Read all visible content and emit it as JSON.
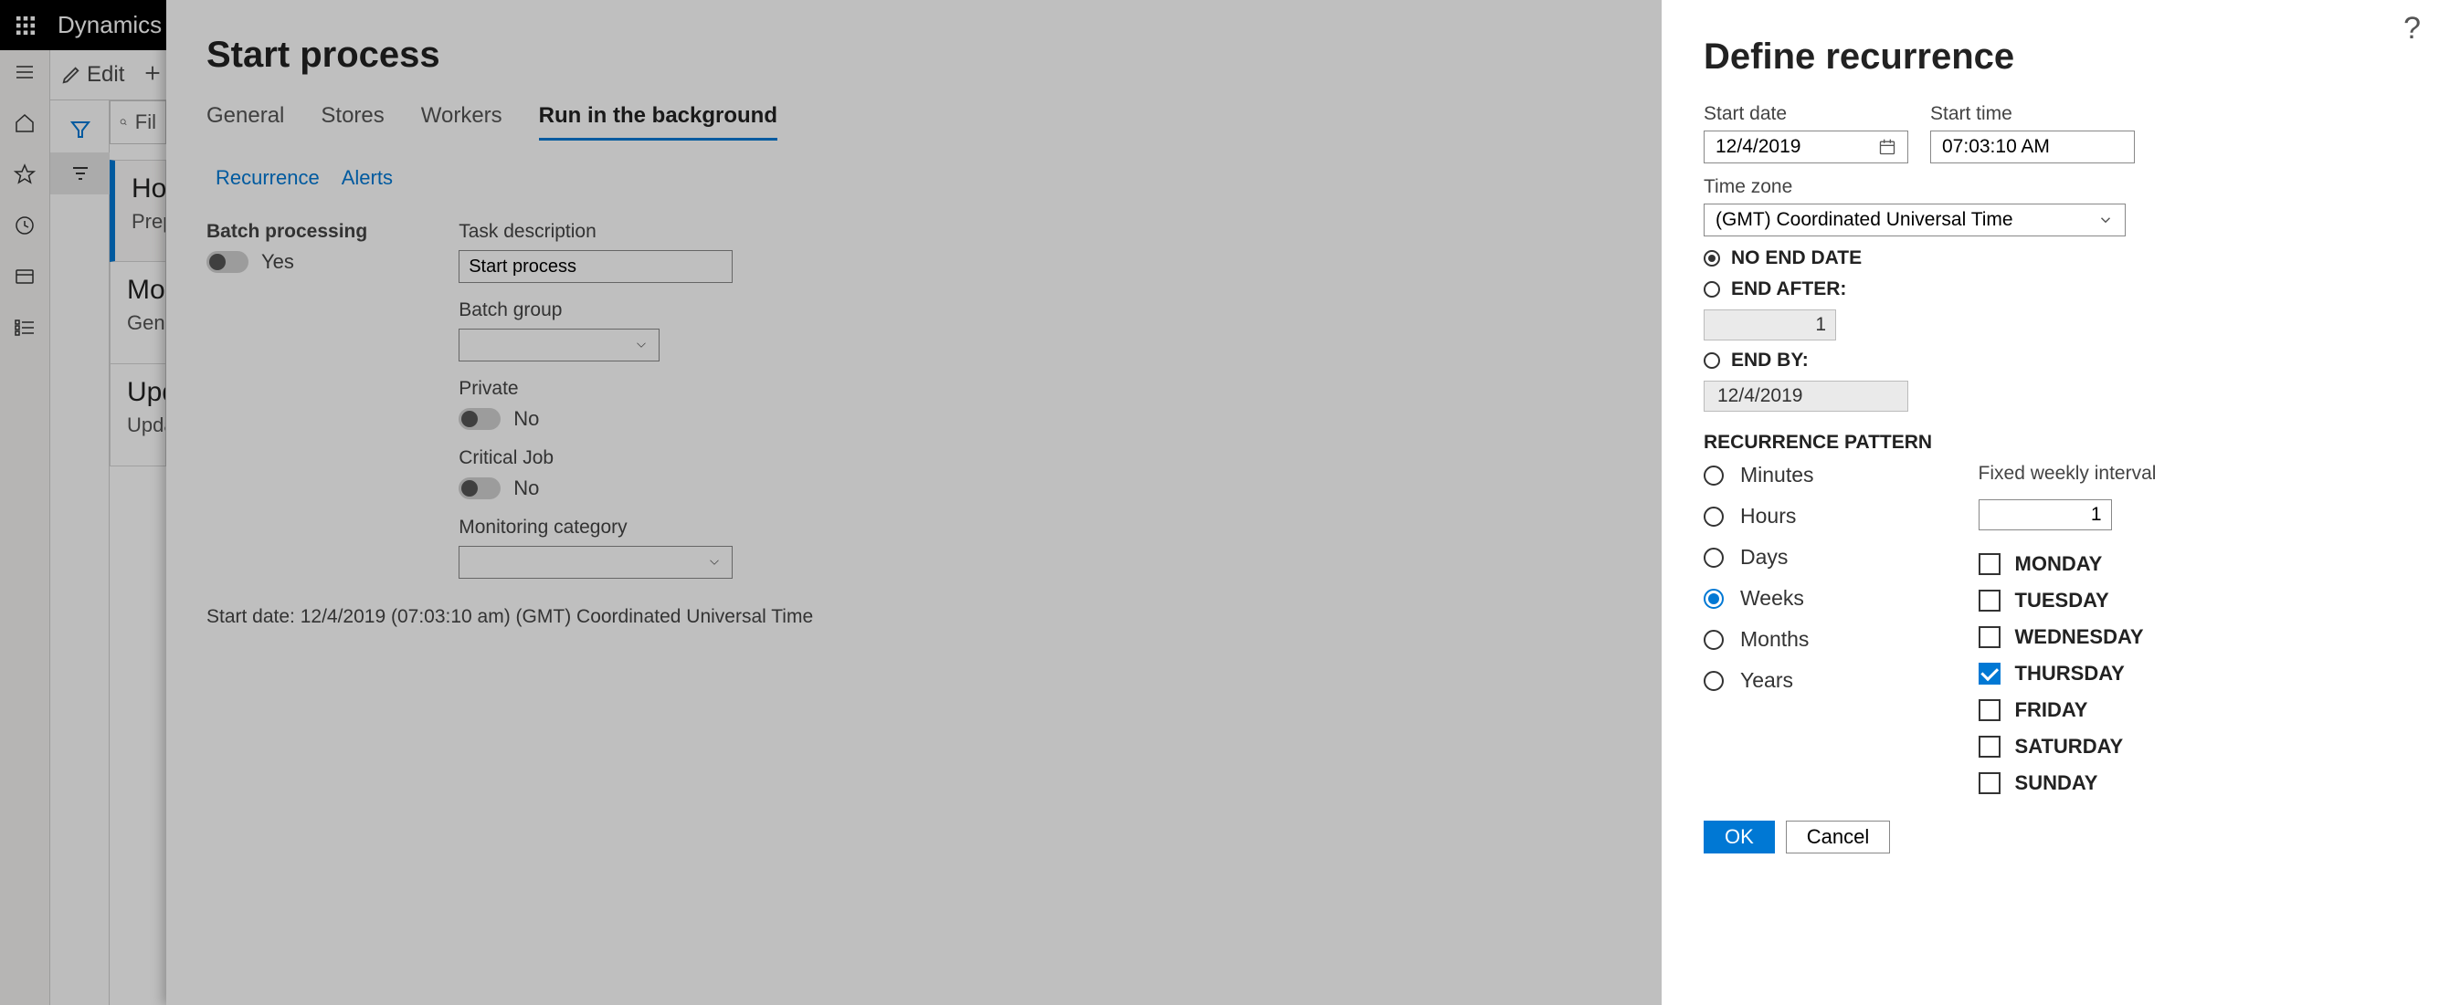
{
  "header": {
    "app_name": "Dynamics"
  },
  "toolbar": {
    "edit_label": "Edit"
  },
  "filter_placeholder": "Fil",
  "cards": [
    {
      "title": "Ho",
      "sub": "Prep"
    },
    {
      "title": "Mo",
      "sub": "Gene"
    },
    {
      "title": "Upd",
      "sub": "Upda"
    }
  ],
  "main": {
    "title": "Start process",
    "tabs": {
      "general": "General",
      "stores": "Stores",
      "workers": "Workers",
      "run_bg": "Run in the background"
    },
    "subtabs": {
      "recurrence": "Recurrence",
      "alerts": "Alerts"
    },
    "batch_processing_label": "Batch processing",
    "batch_processing_value": "Yes",
    "task_description_label": "Task description",
    "task_description_value": "Start process",
    "batch_group_label": "Batch group",
    "batch_group_value": "",
    "private_label": "Private",
    "private_value": "No",
    "critical_label": "Critical Job",
    "critical_value": "No",
    "monitoring_label": "Monitoring category",
    "monitoring_value": "",
    "start_date_note": "Start date: 12/4/2019 (07:03:10 am) (GMT) Coordinated Universal Time"
  },
  "rec": {
    "title": "Define recurrence",
    "start_date_label": "Start date",
    "start_date_value": "12/4/2019",
    "start_time_label": "Start time",
    "start_time_value": "07:03:10 AM",
    "tz_label": "Time zone",
    "tz_value": "(GMT) Coordinated Universal Time",
    "no_end": "NO END DATE",
    "end_after": "END AFTER:",
    "end_after_value": "1",
    "end_by": "END BY:",
    "end_by_value": "12/4/2019",
    "pattern_head": "RECURRENCE PATTERN",
    "units": {
      "minutes": "Minutes",
      "hours": "Hours",
      "days": "Days",
      "weeks": "Weeks",
      "months": "Months",
      "years": "Years"
    },
    "unit_selected": "weeks",
    "fixed_interval_label": "Fixed weekly interval",
    "fixed_interval_value": "1",
    "days": {
      "monday": "MONDAY",
      "tuesday": "TUESDAY",
      "wednesday": "WEDNESDAY",
      "thursday": "THURSDAY",
      "friday": "FRIDAY",
      "saturday": "SATURDAY",
      "sunday": "SUNDAY"
    },
    "day_selected": "thursday",
    "ok": "OK",
    "cancel": "Cancel"
  }
}
